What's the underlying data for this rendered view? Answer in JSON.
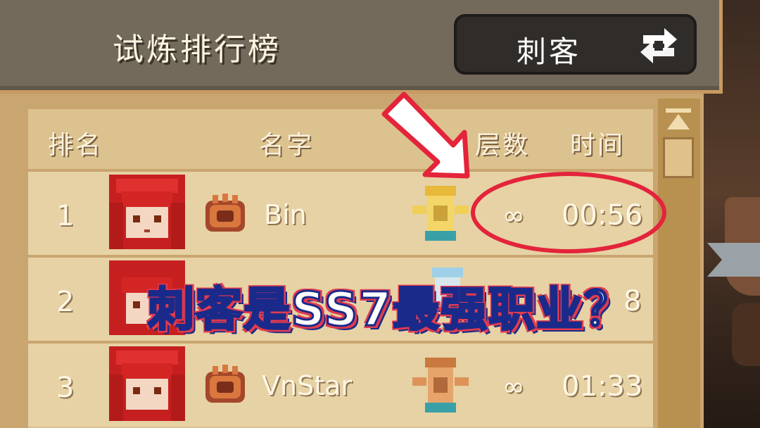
{
  "header": {
    "title": "试炼排行榜",
    "class_select_label": "刺客"
  },
  "columns": {
    "rank": "排名",
    "name": "名字",
    "layers": "层数",
    "time": "时间"
  },
  "rows": [
    {
      "rank": "1",
      "name": "Bin",
      "layers": "∞",
      "time": "00:56",
      "trophy": "gold-trophy-icon"
    },
    {
      "rank": "2",
      "name": "",
      "layers": "",
      "time": "8",
      "trophy": "silver-trophy-icon"
    },
    {
      "rank": "3",
      "name": "VnStar",
      "layers": "∞",
      "time": "01:33",
      "trophy": "bronze-trophy-icon"
    }
  ],
  "overlay": {
    "caption": "刺客是SS7最强职业？"
  },
  "colors": {
    "accent_red": "#e3243b",
    "caption_outline": "#1a2a8a",
    "panel_tan": "#dcc28f",
    "header_gray": "#736a5c"
  }
}
